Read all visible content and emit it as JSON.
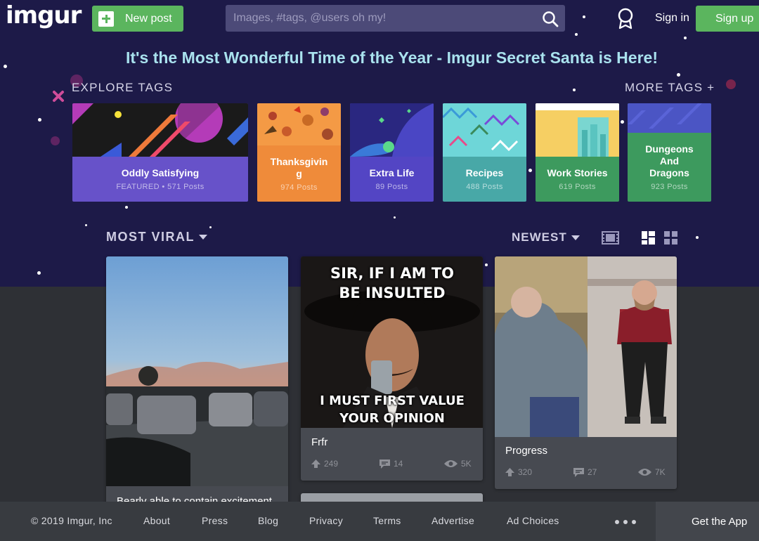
{
  "header": {
    "logo": "imgur",
    "new_post": "New post",
    "search_placeholder": "Images, #tags, @users oh my!",
    "sign_in": "Sign in",
    "sign_up": "Sign up"
  },
  "banner": "It's the Most Wonderful Time of the Year - Imgur Secret Santa is Here!",
  "explore": {
    "heading": "EXPLORE TAGS",
    "more": "MORE TAGS +",
    "tags": [
      {
        "name": "Oddly Satisfying",
        "sub": "FEATURED • 571 Posts",
        "color": "#6752c9"
      },
      {
        "name": "Thanksgivin\ng",
        "sub": "974 Posts",
        "color": "#ef8b3a"
      },
      {
        "name": "Extra Life",
        "sub": "89 Posts",
        "color": "#5345c4"
      },
      {
        "name": "Recipes",
        "sub": "488 Posts",
        "color": "#48a8a7"
      },
      {
        "name": "Work Stories",
        "sub": "619 Posts",
        "color": "#3d9a5e"
      },
      {
        "name": "Dungeons\nAnd\nDragons",
        "sub": "923 Posts",
        "color": "#3d9a5e"
      }
    ]
  },
  "sort": {
    "section": "MOST VIRAL",
    "order": "NEWEST"
  },
  "posts": [
    {
      "title": "Bearly able to contain excitement"
    },
    {
      "title": "Frfr",
      "meme_top": "SIR, IF I AM TO BE INSULTED",
      "meme_bottom": "I MUST FIRST VALUE YOUR OPINION",
      "ups": "249",
      "comments": "14",
      "views": "5K"
    },
    {
      "title": "Progress",
      "ups": "320",
      "comments": "27",
      "views": "7K"
    }
  ],
  "footer": {
    "copyright": "© 2019 Imgur, Inc",
    "links": [
      "About",
      "Press",
      "Blog",
      "Privacy",
      "Terms",
      "Advertise",
      "Ad Choices"
    ],
    "get_app": "Get the App"
  },
  "colors": {
    "hero_bg": "#1d1a48",
    "brand_green": "#5bb55e",
    "banner_text": "#a9e2ee"
  }
}
